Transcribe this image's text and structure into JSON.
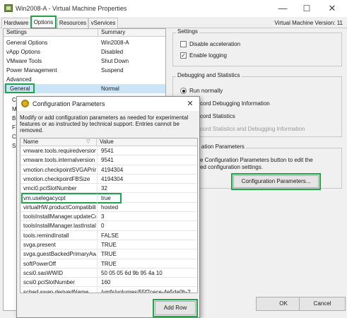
{
  "window": {
    "title": "Win2008-A - Virtual Machine Properties",
    "minimize": "—",
    "maximize": "☐",
    "close": "✕"
  },
  "tabs": [
    {
      "label": "Hardware"
    },
    {
      "label": "Options"
    },
    {
      "label": "Resources"
    },
    {
      "label": "vServices"
    }
  ],
  "vm_version": "Virtual Machine Version: 11",
  "left_list": {
    "col_settings": "Settings",
    "col_summary": "Summary",
    "rows": [
      {
        "setting": "General Options",
        "summary": "Win2008-A"
      },
      {
        "setting": "vApp Options",
        "summary": "Disabled"
      },
      {
        "setting": "VMware Tools",
        "summary": "Shut Down"
      },
      {
        "setting": "Power Management",
        "summary": "Suspend"
      },
      {
        "setting": "Advanced",
        "summary": ""
      },
      {
        "setting": "General",
        "summary": "Normal"
      }
    ],
    "partial": [
      "C",
      "M",
      "B",
      "F",
      "C",
      "S"
    ]
  },
  "settings_group": {
    "label": "Settings",
    "disable_acceleration": "Disable acceleration",
    "enable_logging": "Enable logging"
  },
  "debug_group": {
    "label": "Debugging and Statistics",
    "run_normally": "Run normally",
    "opt2": "cord Debugging Information",
    "opt3": "cord Statistics",
    "opt4": "cord Statistics and Debugging Information"
  },
  "config_group": {
    "label": "ation Parameters",
    "desc_line1": "e Configuration Parameters button to edit the",
    "desc_line2": "ed configuration settings.",
    "button": "Configuration Parameters..."
  },
  "footer": {
    "ok": "OK",
    "cancel": "Cancel"
  },
  "dialog": {
    "title": "Configuration Parameters",
    "close": "✕",
    "description": "Modify or add configuration parameters as needed for experimental features or as instructed by technical support. Entries cannot be removed.",
    "col_name": "Name",
    "col_value": "Value",
    "sort_glyph": "▽",
    "rows": [
      {
        "name": "vmware.tools.requiredversion",
        "value": "9541"
      },
      {
        "name": "vmware.tools.internalversion",
        "value": "9541"
      },
      {
        "name": "vmotion.checkpointSVGAPrimarySize",
        "value": "4194304"
      },
      {
        "name": "vmotion.checkpointFBSize",
        "value": "4194304"
      },
      {
        "name": "vmci0.pciSlotNumber",
        "value": "32"
      },
      {
        "name": "vm.uselegacycpt",
        "value": "true"
      },
      {
        "name": "virtualHW.productCompatibility",
        "value": "hosted"
      },
      {
        "name": "toolsInstallManager.updateCounter",
        "value": "3"
      },
      {
        "name": "toolsInstallManager.lastInstallError",
        "value": "0"
      },
      {
        "name": "tools.remindInstall",
        "value": "FALSE"
      },
      {
        "name": "svga.present",
        "value": "TRUE"
      },
      {
        "name": "svga.guestBackedPrimaryAware",
        "value": "TRUE"
      },
      {
        "name": "softPowerOff",
        "value": "TRUE"
      },
      {
        "name": "scsi0.sasWWID",
        "value": "50 05 05 6d 9b 95 4a 10"
      },
      {
        "name": "scsi0.pciSlotNumber",
        "value": "160"
      },
      {
        "name": "sched.swap.derivedName",
        "value": "/vmfs/volumes/55f7cece-4e5da0b-2"
      }
    ],
    "add_row": "Add Row"
  },
  "colors": {
    "highlight": "#1fa44a",
    "selected_row": "#cce4f7"
  }
}
